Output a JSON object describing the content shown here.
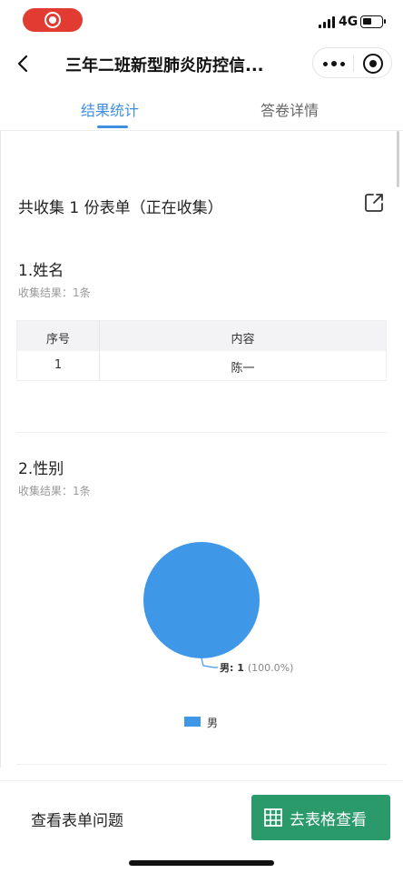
{
  "status_bar": {
    "network": "4G"
  },
  "nav": {
    "title": "三年二班新型肺炎防控信..."
  },
  "tabs": [
    {
      "label": "结果统计",
      "active": true
    },
    {
      "label": "答卷详情",
      "active": false
    }
  ],
  "summary": "共收集 1 份表单（正在收集）",
  "questions": [
    {
      "title": "1.姓名",
      "sub": "收集结果：1条",
      "table": {
        "headers": [
          "序号",
          "内容"
        ],
        "rows": [
          [
            "1",
            "陈一"
          ]
        ]
      }
    },
    {
      "title": "2.性别",
      "sub": "收集结果：1条",
      "chart_data": {
        "type": "pie",
        "categories": [
          "男"
        ],
        "values": [
          1
        ],
        "percentages": [
          "100.0%"
        ],
        "slice_labels": [
          {
            "category": "男",
            "count": "1",
            "percent": "(100.0%)"
          }
        ],
        "legend": [
          "男"
        ],
        "legend_position": "bottom",
        "colors": [
          "#3f97e8"
        ]
      }
    }
  ],
  "bottom_bar": {
    "view_questions": "查看表单问题",
    "go_sheet": "去表格查看"
  },
  "colors": {
    "accent": "#3f8fe0",
    "primary_button": "#2b9a6b",
    "recording": "#e23b31",
    "pie": "#3f97e8"
  }
}
